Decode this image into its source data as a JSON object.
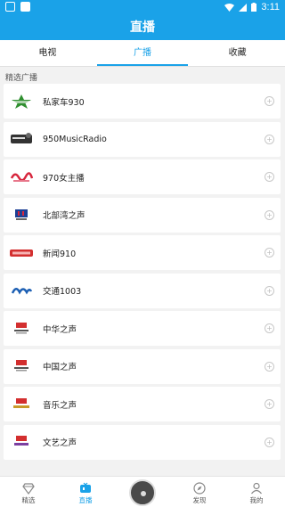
{
  "status": {
    "time": "3:11"
  },
  "header": {
    "title": "直播"
  },
  "tabs": [
    {
      "label": "电视",
      "active": false
    },
    {
      "label": "广播",
      "active": true
    },
    {
      "label": "收藏",
      "active": false
    }
  ],
  "section": {
    "title": "精选广播"
  },
  "stations": [
    {
      "name": "私家车930",
      "logo": "green-star-logo"
    },
    {
      "name": "950MusicRadio",
      "logo": "music-radio-logo"
    },
    {
      "name": "970女主播",
      "logo": "red-script-logo"
    },
    {
      "name": "北部湾之声",
      "logo": "bbr-logo"
    },
    {
      "name": "新闻910",
      "logo": "red-banner-logo"
    },
    {
      "name": "交通1003",
      "logo": "blue-script-logo"
    },
    {
      "name": "中华之声",
      "logo": "cnr-logo"
    },
    {
      "name": "中国之声",
      "logo": "cnr-logo"
    },
    {
      "name": "音乐之声",
      "logo": "cnr-logo"
    },
    {
      "name": "文艺之声",
      "logo": "cnr-logo"
    }
  ],
  "bottom_nav": [
    {
      "label": "精选",
      "icon": "diamond-icon",
      "active": false
    },
    {
      "label": "直播",
      "icon": "tv-icon",
      "active": true
    },
    {
      "label": "发现",
      "icon": "compass-icon",
      "active": false
    },
    {
      "label": "我的",
      "icon": "person-icon",
      "active": false
    }
  ],
  "colors": {
    "primary": "#1aa2e8"
  }
}
